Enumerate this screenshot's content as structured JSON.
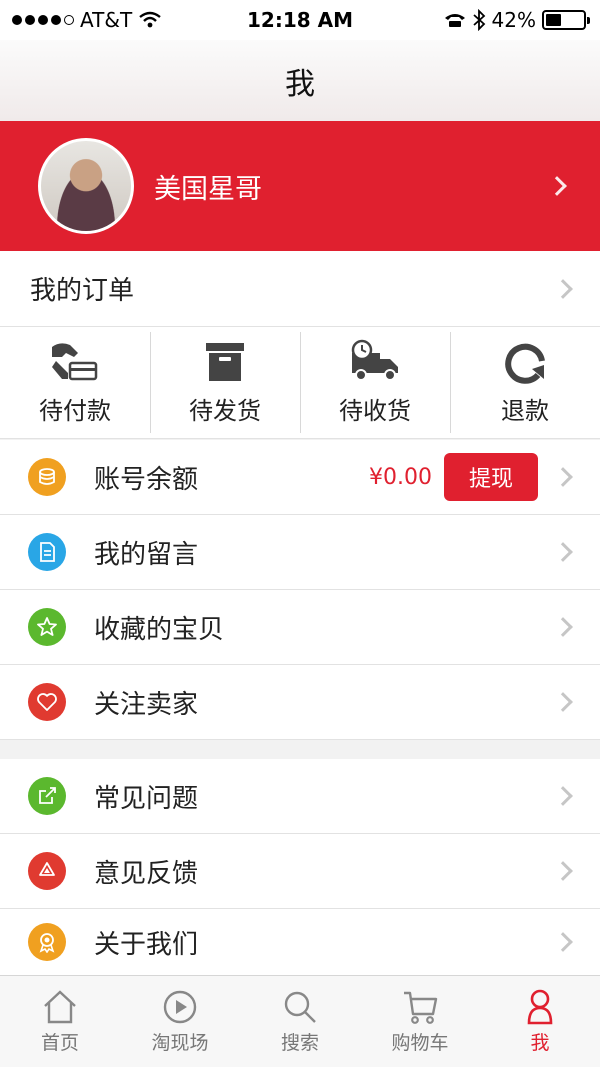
{
  "status_bar": {
    "carrier": "AT&T",
    "time": "12:18 AM",
    "battery": "42%",
    "battery_level": 0.42
  },
  "nav": {
    "title": "我"
  },
  "profile": {
    "name": "美国星哥"
  },
  "orders": {
    "label": "我的订单",
    "statuses": [
      {
        "label": "待付款",
        "icon": "payment-hand-icon"
      },
      {
        "label": "待发货",
        "icon": "box-icon"
      },
      {
        "label": "待收货",
        "icon": "delivery-truck-icon"
      },
      {
        "label": "退款",
        "icon": "refresh-icon"
      }
    ]
  },
  "menu": {
    "balance": {
      "label": "账号余额",
      "amount": "¥0.00",
      "button": "提现",
      "color": "#f0a020"
    },
    "messages": {
      "label": "我的留言",
      "color": "#29a6e6"
    },
    "favorites": {
      "label": "收藏的宝贝",
      "color": "#5bb82e"
    },
    "follow": {
      "label": "关注卖家",
      "color": "#e03a30"
    },
    "faq": {
      "label": "常见问题",
      "color": "#5bb82e"
    },
    "feedback": {
      "label": "意见反馈",
      "color": "#e03a30"
    },
    "about": {
      "label": "关于我们",
      "color": "#f0a020"
    }
  },
  "tabs": [
    {
      "label": "首页",
      "icon": "home-icon"
    },
    {
      "label": "淘现场",
      "icon": "play-icon"
    },
    {
      "label": "搜索",
      "icon": "search-icon"
    },
    {
      "label": "购物车",
      "icon": "cart-icon"
    },
    {
      "label": "我",
      "icon": "person-icon",
      "active": true
    }
  ],
  "colors": {
    "accent": "#e0202f"
  }
}
